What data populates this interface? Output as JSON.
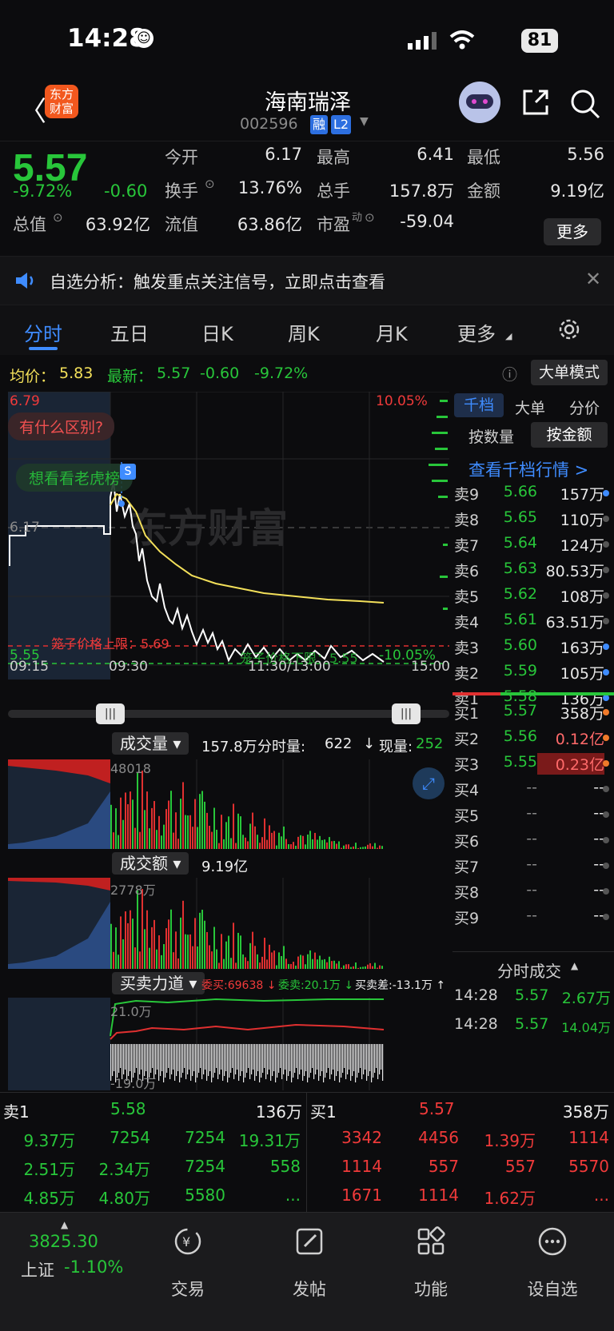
{
  "status": {
    "time": "14:28",
    "battery": "81"
  },
  "header": {
    "title": "海南瑞泽",
    "code": "002596",
    "tag1": "融",
    "tag2": "L2",
    "logo_line1": "东方",
    "logo_line2": "财富"
  },
  "quote": {
    "price": "5.57",
    "pct": "-9.72%",
    "chg": "-0.60",
    "open_label": "今开",
    "open": "6.17",
    "high_label": "最高",
    "high": "6.41",
    "low_label": "最低",
    "low": "5.56",
    "turnover_label": "换手",
    "turnover": "13.76%",
    "volume_label": "总手",
    "volume": "157.8万",
    "amount_label": "金额",
    "amount": "9.19亿",
    "mktcap_label": "总值",
    "mktcap": "63.92亿",
    "float_label": "流值",
    "float": "63.86亿",
    "pe_label": "市盈",
    "pe_sup": "动",
    "pe": "-59.04",
    "more": "更多"
  },
  "notice": {
    "text": "自选分析：触发重点关注信号，立即点击查看"
  },
  "tabs": [
    "分时",
    "五日",
    "日K",
    "周K",
    "月K",
    "更多"
  ],
  "avg": {
    "avg_label": "均价：",
    "avg": "5.83",
    "latest_label": "最新：",
    "latest": "5.57",
    "chg": "-0.60",
    "pct": "-9.72%",
    "mode_btn": "大单模式"
  },
  "chart": {
    "ymax": "6.79",
    "ymin": "5.55",
    "prev_close": "6.17",
    "up_pct": "10.05%",
    "down_pct": "-10.05%",
    "limit_up_text": "笼子价格上限：5.69",
    "limit_down_text": "笼子价格下限：5.55",
    "bubble1": "有什么区别?",
    "bubble2": "想看看老虎榜",
    "marker": "S",
    "watermark": "东方财富",
    "times": [
      "09:15",
      "09:30",
      "11:30/13:00",
      "15:00"
    ]
  },
  "vol_panel": {
    "label": "成交量",
    "total": "157.8万",
    "detail_lbl": "分时量:",
    "detail": "622",
    "arrow": "↓",
    "now_lbl": "现量:",
    "now": "252",
    "max": "48018"
  },
  "amt_panel": {
    "label": "成交额",
    "total": "9.19亿",
    "max": "2778万"
  },
  "force_panel": {
    "label": "买卖力道",
    "buy": "委买:69638 ↓",
    "sell": "委卖:20.1万 ↓",
    "diff": "买卖差:-13.1万 ↑",
    "top": "21.0万",
    "bottom": "-19.0万"
  },
  "orderbook": {
    "tabs": [
      "千档",
      "大单",
      "分价"
    ],
    "sub": [
      "按数量",
      "按金额"
    ],
    "link": "查看千档行情 >",
    "asks": [
      {
        "label": "卖9",
        "price": "5.66",
        "vol": "157万"
      },
      {
        "label": "卖8",
        "price": "5.65",
        "vol": "110万"
      },
      {
        "label": "卖7",
        "price": "5.64",
        "vol": "124万"
      },
      {
        "label": "卖6",
        "price": "5.63",
        "vol": "80.53万"
      },
      {
        "label": "卖5",
        "price": "5.62",
        "vol": "108万"
      },
      {
        "label": "卖4",
        "price": "5.61",
        "vol": "63.51万"
      },
      {
        "label": "卖3",
        "price": "5.60",
        "vol": "163万"
      },
      {
        "label": "卖2",
        "price": "5.59",
        "vol": "105万"
      },
      {
        "label": "卖1",
        "price": "5.58",
        "vol": "136万"
      }
    ],
    "bids": [
      {
        "label": "买1",
        "price": "5.57",
        "vol": "358万"
      },
      {
        "label": "买2",
        "price": "5.56",
        "vol": "0.12亿"
      },
      {
        "label": "买3",
        "price": "5.55",
        "vol": "0.23亿"
      },
      {
        "label": "买4",
        "price": "--",
        "vol": "--"
      },
      {
        "label": "买5",
        "price": "--",
        "vol": "--"
      },
      {
        "label": "买6",
        "price": "--",
        "vol": "--"
      },
      {
        "label": "买7",
        "price": "--",
        "vol": "--"
      },
      {
        "label": "买8",
        "price": "--",
        "vol": "--"
      },
      {
        "label": "买9",
        "price": "--",
        "vol": "--"
      }
    ],
    "ticks_title": "分时成交",
    "ticks": [
      {
        "time": "14:28",
        "price": "5.57",
        "vol": "2.67万"
      },
      {
        "time": "14:28",
        "price": "5.57",
        "vol": "14.04万"
      }
    ]
  },
  "bottom": {
    "sell_head": {
      "label": "卖1",
      "price": "5.58",
      "vol": "136万"
    },
    "buy_head": {
      "label": "买1",
      "price": "5.57",
      "vol": "358万"
    },
    "sell_rows": [
      [
        "9.37万",
        "7254",
        "7254",
        "19.31万"
      ],
      [
        "2.51万",
        "2.34万",
        "7254",
        "558"
      ],
      [
        "4.85万",
        "4.80万",
        "5580",
        "..."
      ]
    ],
    "buy_rows": [
      [
        "3342",
        "4456",
        "1.39万",
        "1114"
      ],
      [
        "1114",
        "557",
        "557",
        "5570"
      ],
      [
        "1671",
        "1114",
        "1.62万",
        "..."
      ]
    ]
  },
  "nav": {
    "index_value": "3825.30",
    "index_name": "上证",
    "index_pct": "-1.10%",
    "items": [
      "交易",
      "发帖",
      "功能",
      "设自选"
    ]
  }
}
